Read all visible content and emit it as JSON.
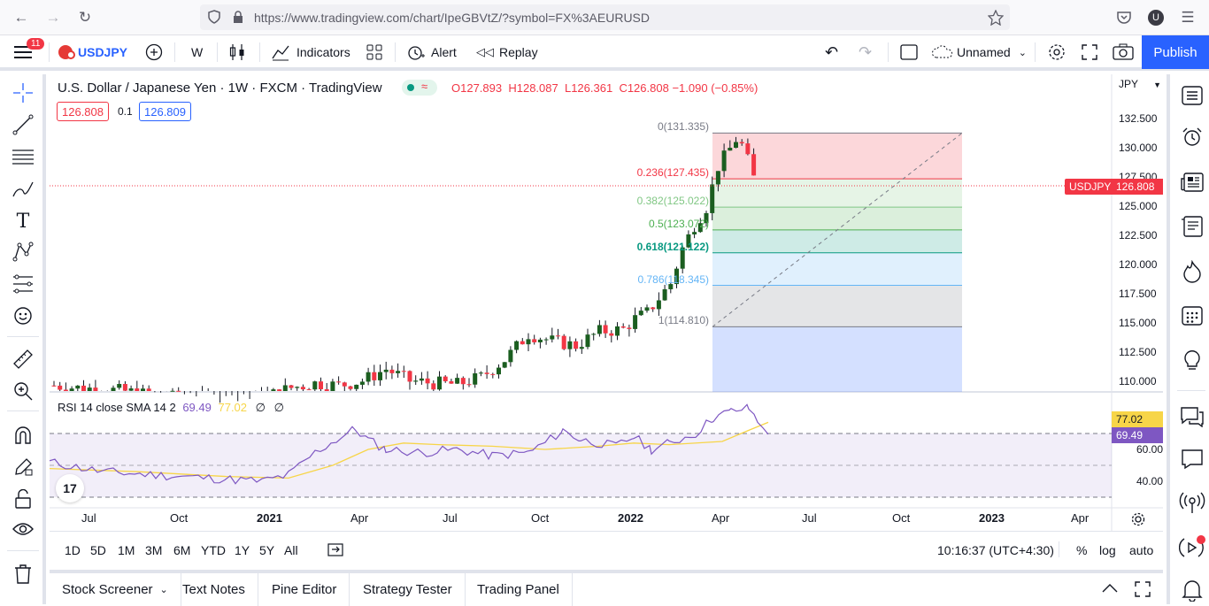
{
  "browser": {
    "url_host": "https://www.tradingview.com",
    "url_path": "/chart/IpeGBVtZ/?symbol=FX%3AEURUSD"
  },
  "toolbar": {
    "menu_badge": "11",
    "symbol": "USDJPY",
    "interval": "W",
    "indicators_label": "Indicators",
    "alert_label": "Alert",
    "replay_label": "Replay",
    "layout_name": "Unnamed",
    "publish_label": "Publish"
  },
  "chart": {
    "title": "U.S. Dollar / Japanese Yen · 1W · FXCM · TradingView",
    "ohlc": {
      "o": "O127.893",
      "h": "H128.087",
      "l": "L126.361",
      "c": "C126.808",
      "change": "−1.090 (−0.85%)"
    },
    "bid": "126.808",
    "spread": "0.1",
    "ask": "126.809",
    "currency": "JPY",
    "last_price_tag": "USDJPY",
    "last_price": "126.808",
    "price_axis": [
      "132.500",
      "130.000",
      "127.500",
      "125.000",
      "122.500",
      "120.000",
      "117.500",
      "115.000",
      "112.500",
      "110.000"
    ],
    "fib_levels": [
      {
        "label": "0(131.335)",
        "color": "#787b86"
      },
      {
        "label": "0.236(127.435)",
        "color": "#f23645"
      },
      {
        "label": "0.382(125.022)",
        "color": "#81c784"
      },
      {
        "label": "0.5(123.072)",
        "color": "#4caf50"
      },
      {
        "label": "0.618(121.122)",
        "color": "#089981"
      },
      {
        "label": "0.786(118.345)",
        "color": "#64b5f6"
      },
      {
        "label": "1(114.810)",
        "color": "#787b86"
      }
    ],
    "rsi": {
      "label": "RSI 14 close SMA 14 2",
      "rsi_value": "69.49",
      "sma_value": "77.02",
      "axis": [
        "60.00",
        "40.00"
      ],
      "rsi_color": "#7e57c2",
      "sma_color": "#f7d548"
    },
    "time_axis": [
      "Jul",
      "Oct",
      "2021",
      "Apr",
      "Jul",
      "Oct",
      "2022",
      "Apr",
      "Jul",
      "Oct",
      "2023",
      "Apr"
    ]
  },
  "range_bar": {
    "ranges": [
      "1D",
      "5D",
      "1M",
      "3M",
      "6M",
      "YTD",
      "1Y",
      "5Y",
      "All"
    ],
    "clock": "10:16:37 (UTC+4:30)",
    "percent": "%",
    "log": "log",
    "auto": "auto"
  },
  "bottom_panels": [
    "Stock Screener",
    "Text Notes",
    "Pine Editor",
    "Strategy Tester",
    "Trading Panel"
  ],
  "colors": {
    "accent": "#2962ff",
    "up": "#1b5e20",
    "down": "#f23645"
  }
}
